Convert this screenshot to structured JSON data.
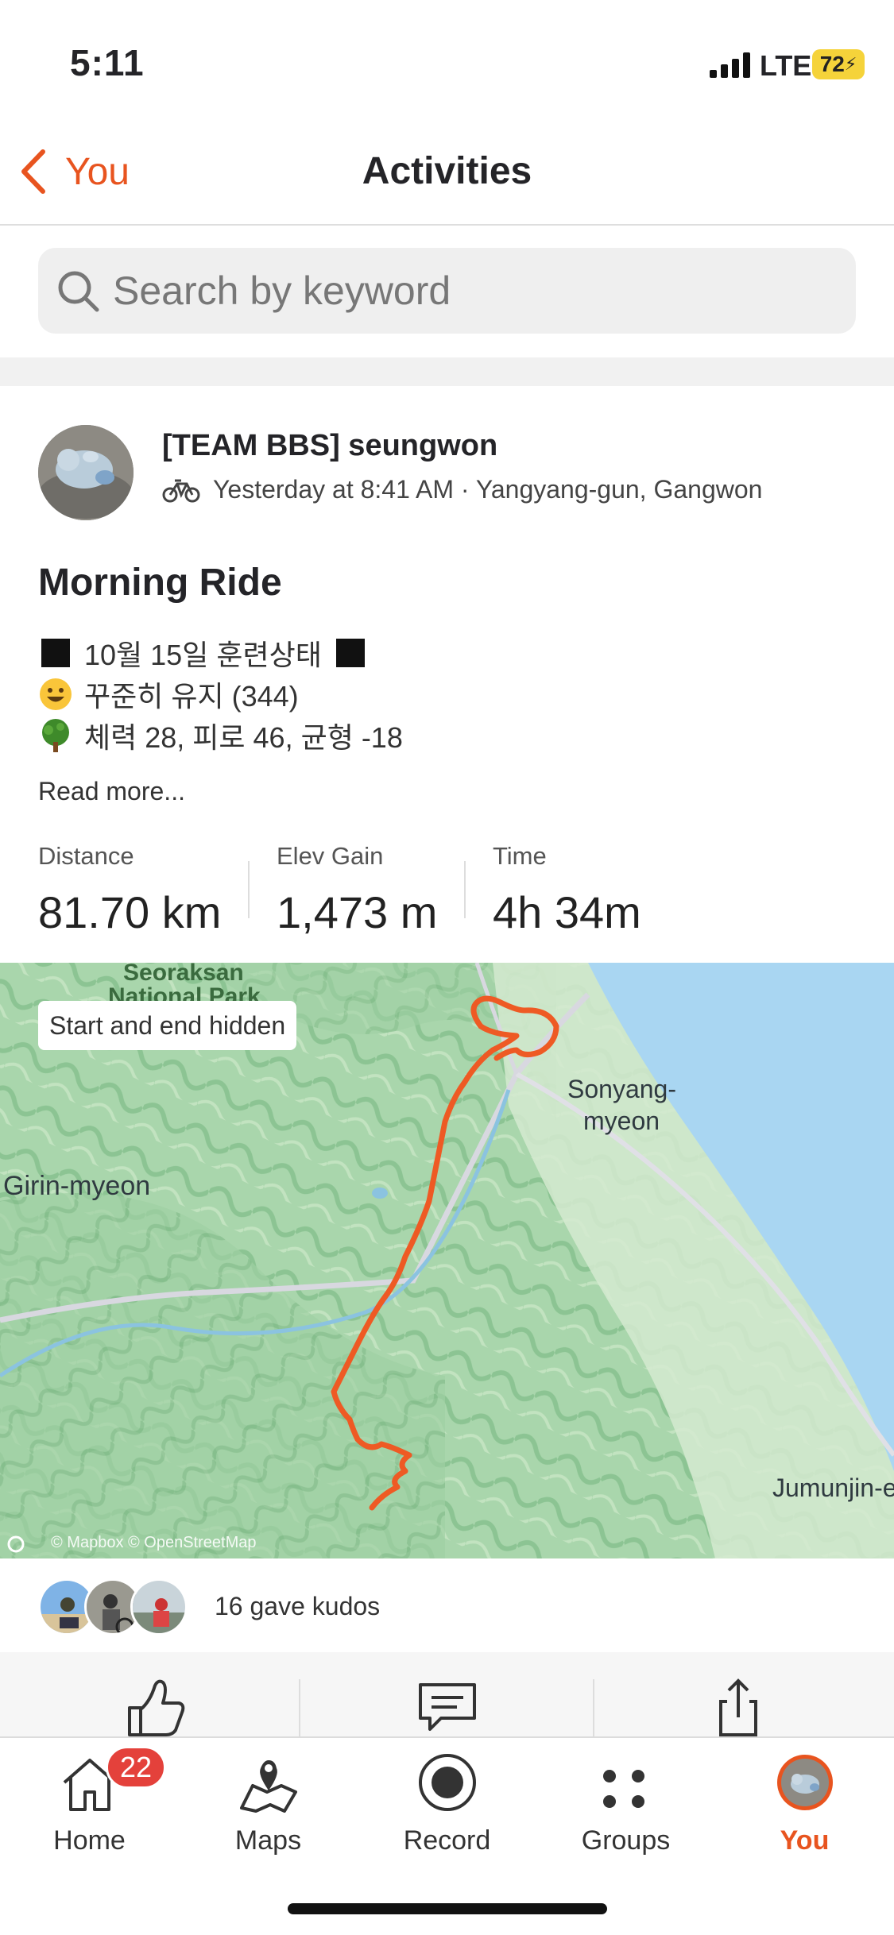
{
  "status_bar": {
    "time": "5:11",
    "network": "LTE",
    "battery": "72"
  },
  "nav": {
    "back_label": "You",
    "title": "Activities"
  },
  "search": {
    "placeholder": "Search by keyword"
  },
  "activity": {
    "athlete": "[TEAM BBS] seungwon",
    "sport_icon": "bicycle-icon",
    "meta": "Yesterday at 8:41 AM · Yangyang-gun, Gangwon",
    "title": "Morning Ride",
    "description": [
      {
        "icon": "black-square-icon",
        "text": "10월 15일 훈련상태"
      },
      {
        "icon": "smiley-icon",
        "text": "꾸준히 유지 (344)"
      },
      {
        "icon": "tree-icon",
        "text": "체력 28, 피로 46, 균형 -18"
      }
    ],
    "read_more": "Read more...",
    "stats": [
      {
        "label": "Distance",
        "value": "81.70 km"
      },
      {
        "label": "Elev Gain",
        "value": "1,473 m"
      },
      {
        "label": "Time",
        "value": "4h 34m"
      }
    ]
  },
  "map": {
    "privacy_label": "Start and end hidden",
    "place_labels": [
      "Seoraksan",
      "National Park",
      "Sonyang-",
      "myeon",
      "Girin-myeon",
      "Jumunjin-e"
    ],
    "attribution": "© Mapbox © OpenStreetMap",
    "route_color": "#ee5a24"
  },
  "kudos": {
    "text": "16 gave kudos"
  },
  "actions": {
    "icons": [
      "thumbs-up-icon",
      "comment-icon",
      "share-icon"
    ]
  },
  "tabbar": {
    "items": [
      {
        "label": "Home",
        "icon": "home-icon"
      },
      {
        "label": "Maps",
        "icon": "maps-icon"
      },
      {
        "label": "Record",
        "icon": "record-icon"
      },
      {
        "label": "Groups",
        "icon": "groups-icon"
      },
      {
        "label": "You",
        "icon": "profile-avatar"
      }
    ],
    "home_badge": "22",
    "active": "You"
  },
  "colors": {
    "accent": "#e8541f",
    "badge": "#e4413b"
  }
}
